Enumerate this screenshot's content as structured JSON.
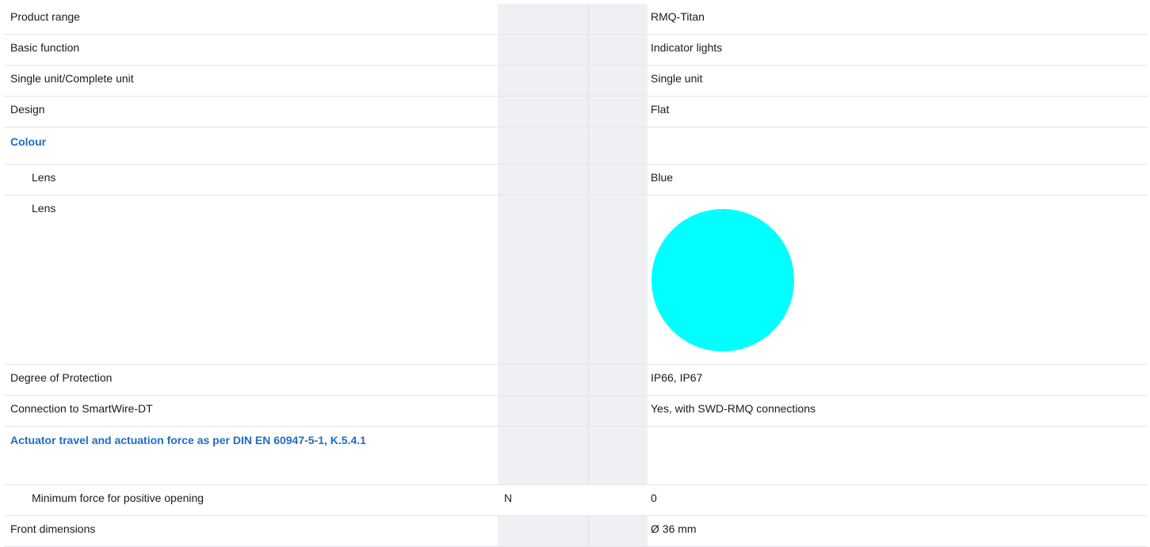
{
  "rows": [
    {
      "label": "Product range",
      "unit": "",
      "value": "RMQ-Titan"
    },
    {
      "label": "Basic function",
      "unit": "",
      "value": "Indicator lights"
    },
    {
      "label": "Single unit/Complete unit",
      "unit": "",
      "value": "Single unit"
    },
    {
      "label": "Design",
      "unit": "",
      "value": "Flat"
    }
  ],
  "colour_section": {
    "title": "Colour",
    "lens_label": "Lens",
    "lens_value": "Blue",
    "lens_image_label": "Lens",
    "lens_swatch_color": "#00ffff"
  },
  "rows_after_colour": [
    {
      "label": "Degree of Protection",
      "unit": "",
      "value": "IP66, IP67"
    },
    {
      "label": "Connection to SmartWire-DT",
      "unit": "",
      "value": "Yes, with SWD-RMQ connections"
    }
  ],
  "actuator_section": {
    "title": "Actuator travel and actuation force as per DIN EN 60947-5-1, K.5.4.1",
    "min_force_label": "Minimum force for positive opening",
    "min_force_unit": "N",
    "min_force_value": "0"
  },
  "front_dimensions": {
    "label": "Front dimensions",
    "unit": "",
    "value": "Ø 36 mm"
  }
}
